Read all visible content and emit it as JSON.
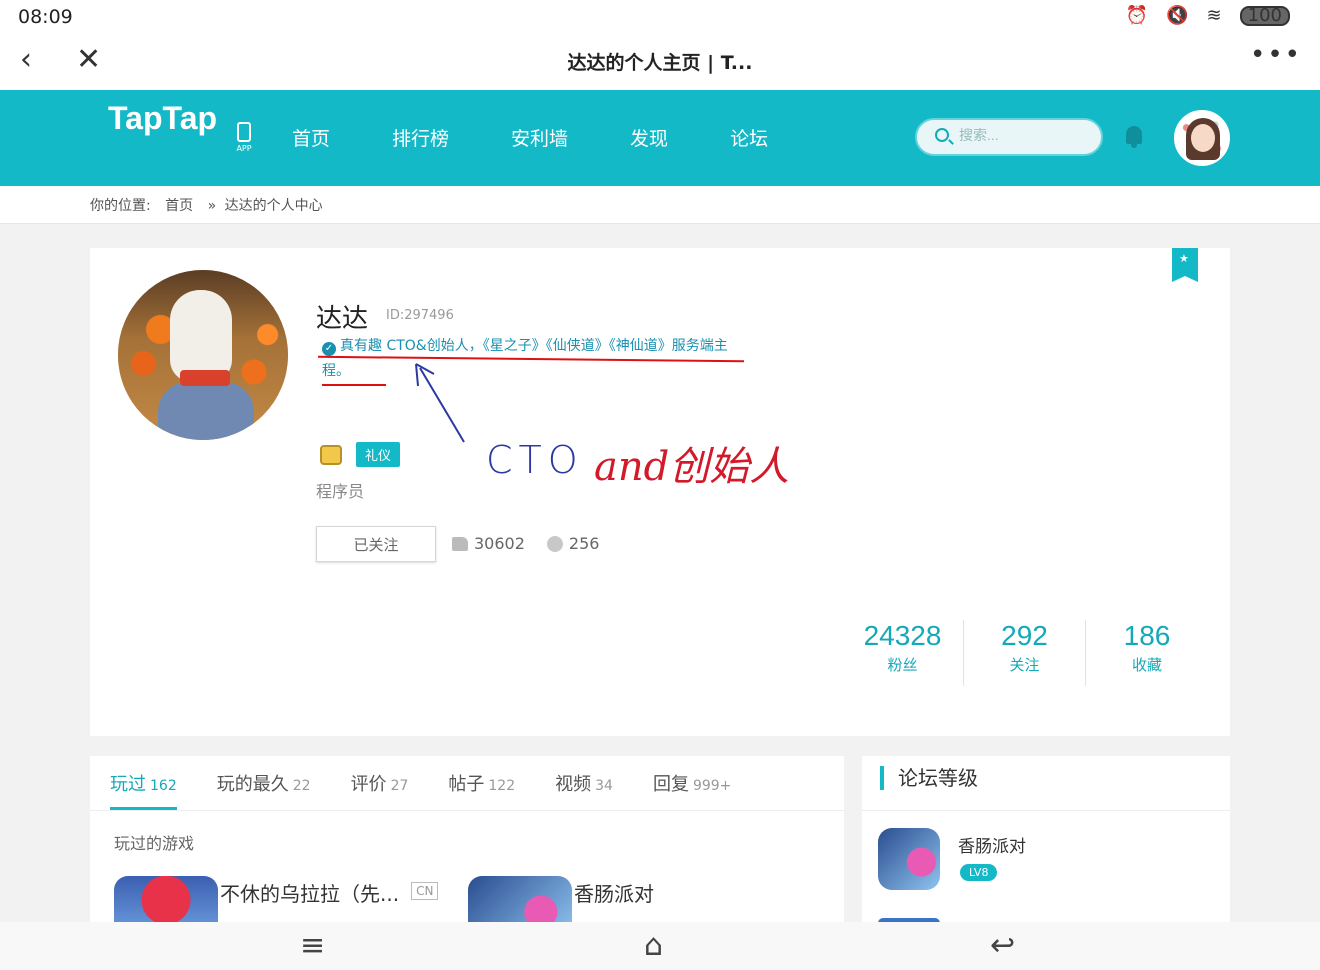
{
  "status_bar": {
    "time": "08:09",
    "icons": [
      "alarm-icon",
      "mute-icon",
      "wifi-icon"
    ],
    "battery": "100"
  },
  "browser": {
    "title": "达达的个人主页 | T...",
    "back_glyph": "‹",
    "close_glyph": "✕",
    "more_glyph": "•••"
  },
  "header": {
    "logo": "TapTap",
    "app_label": "APP",
    "nav": [
      "首页",
      "排行榜",
      "安利墙",
      "发现",
      "论坛"
    ],
    "search_placeholder": "搜索..."
  },
  "breadcrumb": {
    "prefix": "你的位置:",
    "home": "首页",
    "separator": "»",
    "current": "达达的个人中心"
  },
  "profile": {
    "name": "达达",
    "id": "ID:297496",
    "bio": "真有趣 CTO&创始人，《星之子》《仙侠道》《神仙道》服务端主程。",
    "verify_glyph": "✓",
    "badge": "礼仪",
    "title": "程序员",
    "follow_button": "已关注",
    "likes": "30602",
    "smiles": "256",
    "bookmark_glyph": "★",
    "stats": [
      {
        "value": "24328",
        "label": "粉丝"
      },
      {
        "value": "292",
        "label": "关注"
      },
      {
        "value": "186",
        "label": "收藏"
      }
    ],
    "annotation": {
      "cto": "CTO",
      "founder": "and创始人",
      "color_cto": "#2c3aa0",
      "color_founder": "#d21a2a"
    }
  },
  "tabs": [
    {
      "label": "玩过",
      "count": "162",
      "active": true
    },
    {
      "label": "玩的最久",
      "count": "22"
    },
    {
      "label": "评价",
      "count": "27"
    },
    {
      "label": "帖子",
      "count": "122"
    },
    {
      "label": "视频",
      "count": "34"
    },
    {
      "label": "回复",
      "count": "999+"
    }
  ],
  "played": {
    "section_label": "玩过的游戏",
    "games": [
      {
        "name": "不休的乌拉拉（先...",
        "tag": "CN"
      },
      {
        "name": "香肠派对"
      }
    ]
  },
  "forum": {
    "title": "论坛等级",
    "entries": [
      {
        "name": "香肠派对",
        "level": "LV8"
      }
    ]
  },
  "bottom_nav": {
    "menu": "≡",
    "home": "⌂",
    "back": "↩"
  },
  "colors": {
    "accent": "#14b9c8",
    "accent_dark": "#14a9b8",
    "annotation_red": "#d11"
  }
}
